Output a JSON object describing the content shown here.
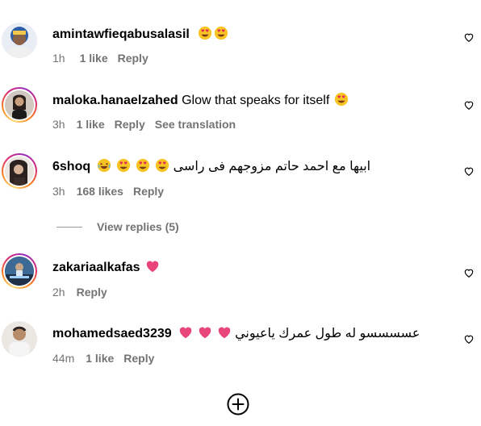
{
  "comments": [
    {
      "user": "amintawfieqabusalasil",
      "text": "",
      "emojis": [
        "heart-eyes",
        "heart-eyes"
      ],
      "time": "1h",
      "likes": "1 like",
      "reply": "Reply",
      "translate": ""
    },
    {
      "user": "maloka.hanaelzahed",
      "text": "Glow that speaks for itself",
      "emojis": [
        "heart-eyes"
      ],
      "time": "3h",
      "likes": "1 like",
      "reply": "Reply",
      "translate": "See translation"
    },
    {
      "user": "6shoq",
      "text": "ابيها مع احمد حاتم مزوجهم فى راسى",
      "emojis": [
        "laughing",
        "heart-eyes",
        "heart-eyes",
        "heart-eyes"
      ],
      "time": "3h",
      "likes": "168 likes",
      "reply": "Reply",
      "translate": ""
    },
    {
      "user": "zakariaalkafas",
      "text": "",
      "emojis": [
        "pink-heart"
      ],
      "time": "2h",
      "likes": "",
      "reply": "Reply",
      "translate": ""
    },
    {
      "user": "mohamedsaed3239",
      "text": "عسسسسو له طول عمرك ياعيوني",
      "emojis": [
        "pink-heart",
        "pink-heart",
        "pink-heart"
      ],
      "time": "44m",
      "likes": "1 like",
      "reply": "Reply",
      "translate": ""
    }
  ],
  "view_replies": "View replies (5)",
  "icons": {
    "like": "heart-outline-icon",
    "add": "plus-circle-icon"
  }
}
